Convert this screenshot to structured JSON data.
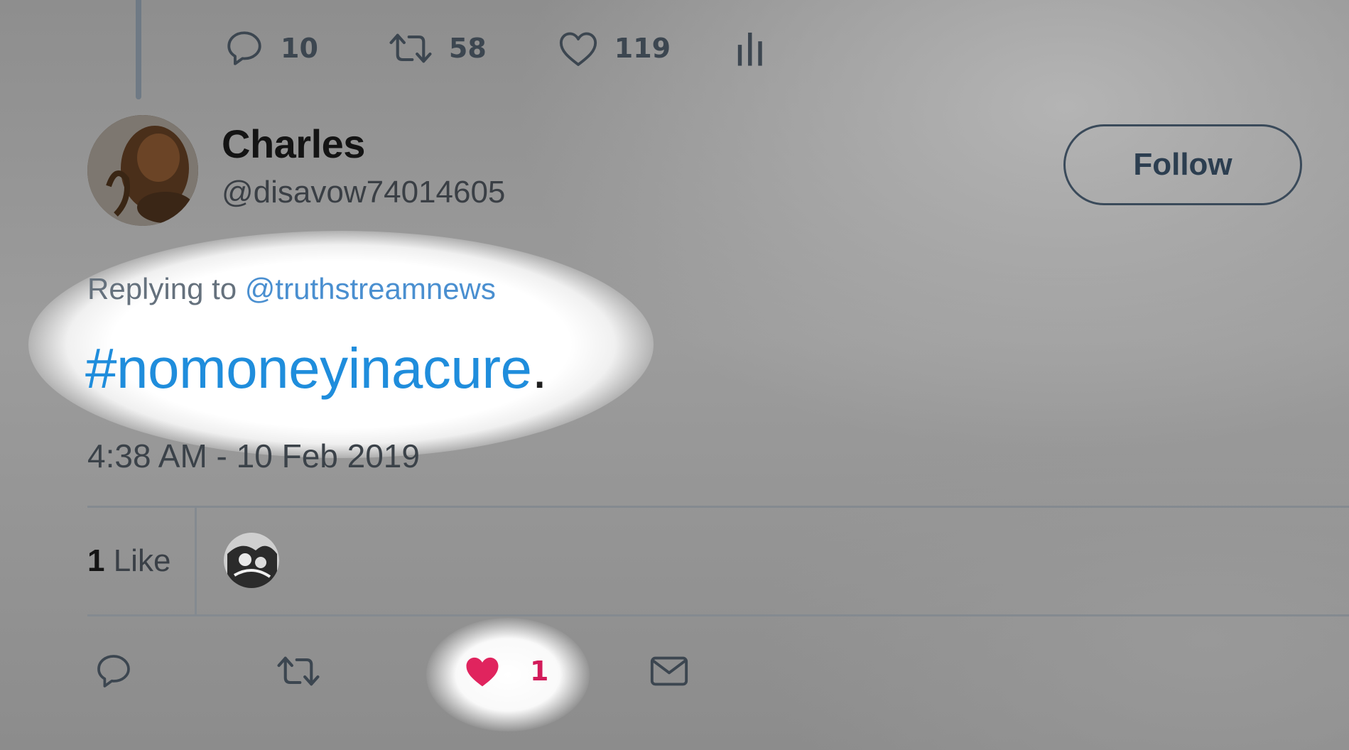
{
  "top_actions": {
    "reply_count": "10",
    "retweet_count": "58",
    "like_count": "119"
  },
  "tweet": {
    "author_name": "Charles",
    "author_handle": "@disavow74014605",
    "follow_label": "Follow",
    "replying_prefix": "Replying to ",
    "replying_to": "@truthstreamnews",
    "hashtag": "#nomoneyinacure",
    "text_suffix": ".",
    "timestamp": "4:38 AM - 10 Feb 2019"
  },
  "stats": {
    "likes_number": "1",
    "likes_label": " Like"
  },
  "bottom_actions": {
    "like_count": "1"
  },
  "colors": {
    "hashtag": "#1f8ddc",
    "mention": "#4a8fd0",
    "liked_heart": "#d21b5a"
  },
  "icons": [
    "reply-icon",
    "retweet-icon",
    "heart-icon",
    "analytics-icon",
    "mail-icon"
  ]
}
